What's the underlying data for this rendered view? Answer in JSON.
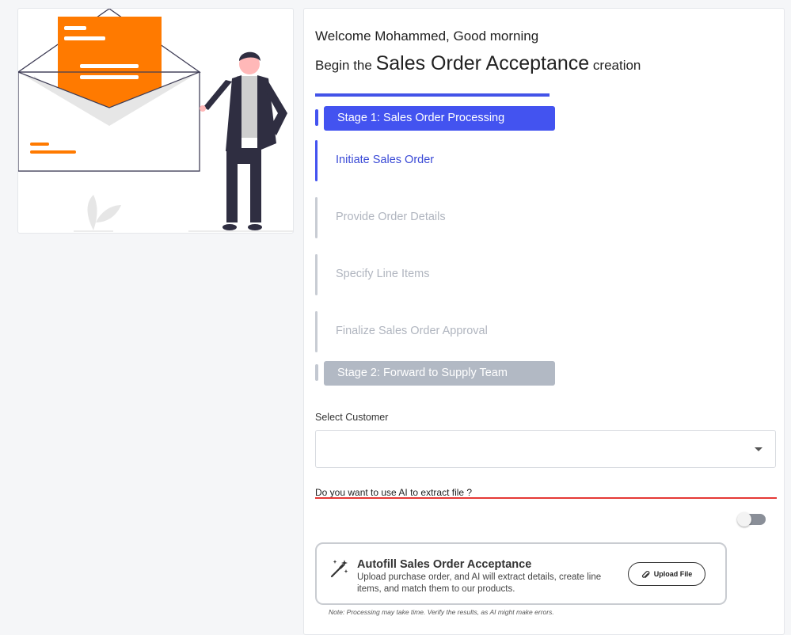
{
  "welcome": "Welcome Mohammed, Good morning",
  "begin": {
    "prefix": "Begin the",
    "emphasis": "Sales Order Acceptance",
    "suffix": "creation"
  },
  "stages": [
    {
      "label": "Stage 1: Sales Order Processing",
      "state": "active"
    },
    {
      "label": "Stage 2: Forward to Supply Team",
      "state": "pending"
    }
  ],
  "steps": [
    {
      "label": "Initiate Sales Order",
      "state": "active"
    },
    {
      "label": "Provide Order Details",
      "state": "pending"
    },
    {
      "label": "Specify Line Items",
      "state": "pending"
    },
    {
      "label": "Finalize Sales Order Approval",
      "state": "pending"
    }
  ],
  "customer": {
    "label": "Select Customer",
    "value": ""
  },
  "ai": {
    "question": "Do you want to use AI to extract file ?",
    "enabled": false
  },
  "autofill": {
    "title": "Autofill Sales Order Acceptance",
    "description": "Upload purchase order, and AI will extract details, create line items, and match them to our products.",
    "button_label": "Upload File",
    "button_icon": "paperclip-icon",
    "icon": "magic-wand-icon",
    "note": "Note: Processing may take time. Verify the results, as AI might make errors."
  },
  "colors": {
    "accent": "#4353f0",
    "illustration_orange": "#ff7a00",
    "ai_rule": "#e53935",
    "pending": "#b2b9c4"
  }
}
